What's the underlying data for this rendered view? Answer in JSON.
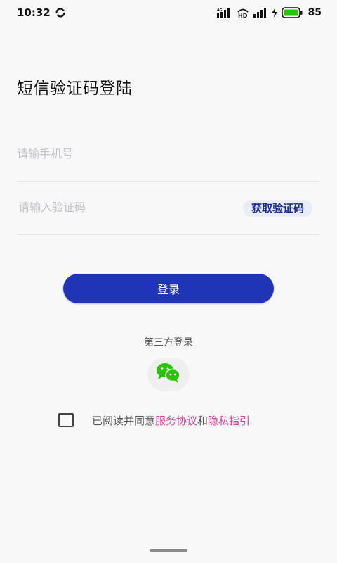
{
  "status_bar": {
    "time": "10:32",
    "network_label_1": "4G",
    "network_label_2": "HD",
    "battery_level": "85"
  },
  "page_title": "短信验证码登陆",
  "phone_input": {
    "placeholder": "请输手机号",
    "value": ""
  },
  "code_input": {
    "placeholder": "请输入验证码",
    "value": ""
  },
  "get_code_label": "获取验证码",
  "login_label": "登录",
  "third_party_label": "第三方登录",
  "agreement": {
    "checked": false,
    "prefix": "已阅读并同意",
    "service_link": "服务协议",
    "connector": "和",
    "privacy_link": "隐私指引"
  },
  "colors": {
    "primary": "#2034b8",
    "link": "#d6439c",
    "wechat": "#2dc100",
    "battery": "#2dc100"
  },
  "icons": [
    "sync-icon",
    "signal-icon",
    "hd-icon",
    "battery-icon",
    "wechat-icon"
  ]
}
